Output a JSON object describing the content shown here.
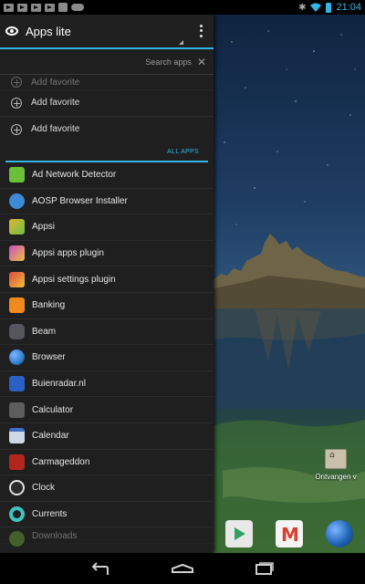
{
  "status_bar": {
    "time": "21:04",
    "icons": [
      "notification-play-icon",
      "notification-play-icon",
      "notification-play-icon",
      "notification-play-icon",
      "play-store-bag-icon",
      "gamepad-icon",
      "bluetooth-icon",
      "wifi-icon",
      "battery-icon"
    ]
  },
  "action_bar": {
    "title": "Apps lite",
    "menu_icon": "overflow-menu-icon"
  },
  "search": {
    "placeholder": "Search apps",
    "clear_icon": "close-icon"
  },
  "favorites": {
    "items": [
      {
        "label": "Add favorite"
      },
      {
        "label": "Add favorite"
      },
      {
        "label": "Add favorite"
      }
    ]
  },
  "all_apps": {
    "header": "ALL APPS",
    "items": [
      {
        "label": "Ad Network Detector",
        "icon": "ad-network-detector-icon",
        "color": "#6cbf3b"
      },
      {
        "label": "AOSP Browser Installer",
        "icon": "aosp-browser-icon",
        "color": "#3e8ad6"
      },
      {
        "label": "Appsi",
        "icon": "appsi-icon",
        "color": "#e2b338"
      },
      {
        "label": "Appsi apps plugin",
        "icon": "appsi-plugin-icon",
        "color": "#c84cc4"
      },
      {
        "label": "Appsi settings plugin",
        "icon": "appsi-settings-icon",
        "color": "#d94b3a"
      },
      {
        "label": "Banking",
        "icon": "banking-icon",
        "color": "#f08a1d"
      },
      {
        "label": "Beam",
        "icon": "beam-icon",
        "color": "#55575c"
      },
      {
        "label": "Browser",
        "icon": "browser-globe-icon",
        "color": "#2f7fd1"
      },
      {
        "label": "Buienradar.nl",
        "icon": "buienradar-icon",
        "color": "#2b61c2"
      },
      {
        "label": "Calculator",
        "icon": "calculator-icon",
        "color": "#5d5d5d"
      },
      {
        "label": "Calendar",
        "icon": "calendar-icon",
        "color": "#cfd8e6"
      },
      {
        "label": "Carmageddon",
        "icon": "carmageddon-icon",
        "color": "#b3261e"
      },
      {
        "label": "Clock",
        "icon": "clock-icon",
        "color": "#e0e0e0"
      },
      {
        "label": "Currents",
        "icon": "currents-icon",
        "color": "#3fc2c2"
      },
      {
        "label": "Downloads",
        "icon": "downloads-icon",
        "color": "#7dbf3f"
      }
    ]
  },
  "wallpaper": {
    "folder_label": "Ontvangen v",
    "folder_icon": "bluetooth-folder-icon",
    "dock": [
      "play-store-icon",
      "gmail-icon",
      "browser-globe-icon"
    ]
  },
  "nav_bar": {
    "buttons": [
      "back-icon",
      "home-icon",
      "recents-icon"
    ]
  },
  "colors": {
    "accent": "#33b5e5",
    "drawer_bg": "#1f1f1f"
  }
}
